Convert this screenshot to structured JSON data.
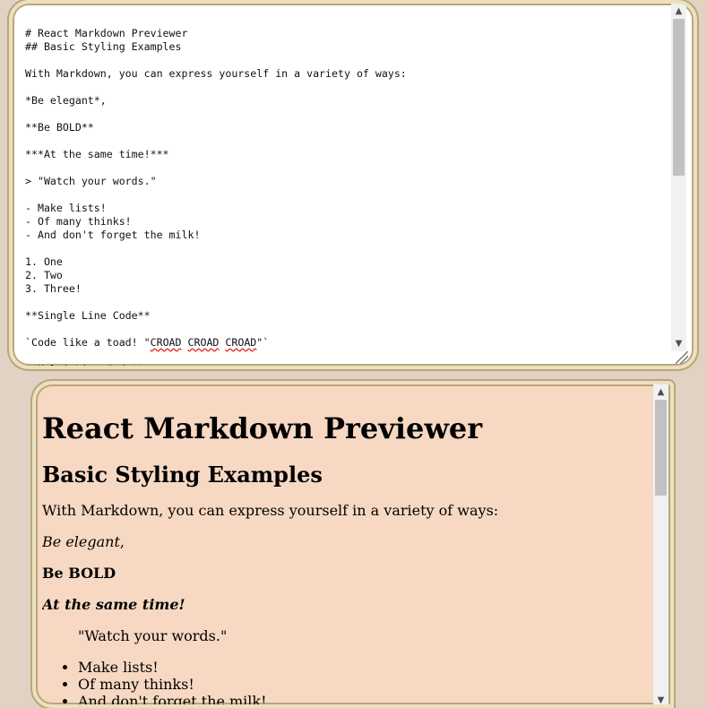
{
  "editor": {
    "lines": [
      "# React Markdown Previewer",
      "## Basic Styling Examples",
      "",
      "With Markdown, you can express yourself in a variety of ways:",
      "",
      "*Be elegant*,",
      "",
      "**Be BOLD**",
      "",
      "***At the same time!***",
      "",
      "> \"Watch your words.\"",
      "",
      "- Make lists!",
      "- Of many thinks!",
      "- And don't forget the milk!",
      "",
      "1. One",
      "2. Two",
      "3. Three!",
      "",
      "**Single Line Code**",
      ""
    ],
    "code_line_prefix": "`Code like a toad! \"",
    "code_line_words": [
      "CROAD",
      "CROAD",
      "CROAD"
    ],
    "code_line_suffix": "\"`",
    "partial_line": "**Multi-Line Code**"
  },
  "preview": {
    "h1": "React Markdown Previewer",
    "h2": "Basic Styling Examples",
    "intro": "With Markdown, you can express yourself in a variety of ways:",
    "elegant": "Be elegant",
    "elegant_suffix": ",",
    "bold": "Be BOLD",
    "bold_italic": "At the same time!",
    "quote": "\"Watch your words.\"",
    "list": [
      "Make lists!",
      "Of many thinks!",
      "And don't forget the milk!"
    ]
  },
  "icons": {
    "scroll_up": "▲",
    "scroll_down": "▼"
  }
}
